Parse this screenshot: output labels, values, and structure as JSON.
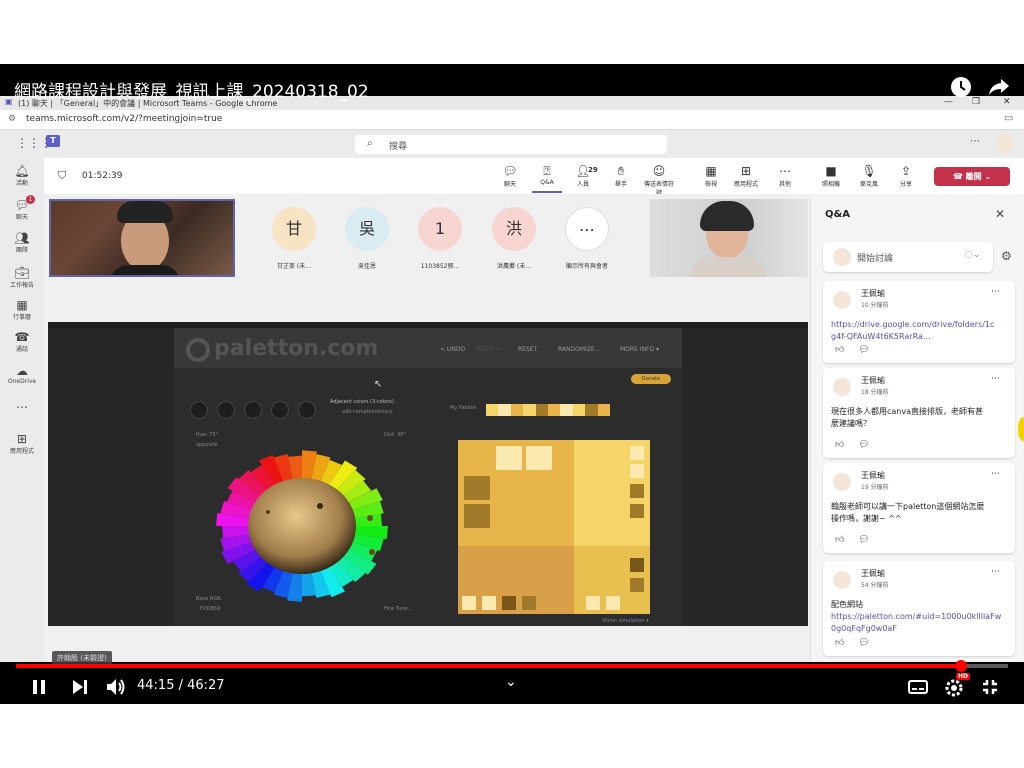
{
  "youtube": {
    "title": "網路課程設計與發展_視訊上課_20240318_02",
    "time_display": "44:15 / 46:27",
    "progress": 0.953,
    "caption_label": "許翰殷 (未驗證)",
    "hd_badge": "HD"
  },
  "chrome": {
    "window_title": "(1) 聊天 | 「General」中的會議 | Microsoft Teams - Google Chrome",
    "url": "teams.microsoft.com/v2/?meetingjoin=true"
  },
  "teams": {
    "search_placeholder": "搜尋",
    "rail": [
      {
        "label": "活動",
        "icon": "bell-icon"
      },
      {
        "label": "聊天",
        "icon": "chat-icon",
        "badge": "1"
      },
      {
        "label": "團隊",
        "icon": "teams-icon"
      },
      {
        "label": "工作報告",
        "icon": "briefcase-icon"
      },
      {
        "label": "行事曆",
        "icon": "calendar-icon"
      },
      {
        "label": "通話",
        "icon": "phone-icon"
      },
      {
        "label": "OneDrive",
        "icon": "cloud-icon"
      },
      {
        "label": "",
        "icon": "more-icon"
      },
      {
        "label": "應用程式",
        "icon": "add-apps-icon"
      }
    ],
    "meeting": {
      "timer": "01:52:39",
      "buttons": [
        {
          "label": "聊天",
          "icon": "chat-icon"
        },
        {
          "label": "Q&A",
          "icon": "qa-icon"
        },
        {
          "label": "人員",
          "icon": "people-icon",
          "count": "29"
        },
        {
          "label": "舉手",
          "icon": "hand-icon"
        },
        {
          "label": "傳送表情符號",
          "icon": "emoji-icon"
        },
        {
          "label": "檢視",
          "icon": "view-icon"
        },
        {
          "label": "應用程式",
          "icon": "apps-icon"
        },
        {
          "label": "其他",
          "icon": "more-icon"
        },
        {
          "label": "照相機",
          "icon": "camera-icon"
        },
        {
          "label": "麥克風",
          "icon": "mic-icon"
        },
        {
          "label": "分享",
          "icon": "share-icon"
        }
      ],
      "leave_label": "離開"
    },
    "participants": [
      {
        "initial": "甘",
        "name": "甘芷寧 (未...",
        "color": "#f7e4c4"
      },
      {
        "initial": "吳",
        "name": "吳佳恩",
        "color": "#d8ecf2"
      },
      {
        "initial": "1",
        "name": "1103852郭...",
        "color": "#f7d6d2"
      },
      {
        "initial": "洪",
        "name": "洪農蓁 (未...",
        "color": "#f7d6d2"
      },
      {
        "initial": "⋯",
        "name": "顯示所有與會者",
        "color": "#ffffff"
      }
    ]
  },
  "shared_screen": {
    "logo": "paletton.com",
    "menu": [
      "< UNDO",
      "REDO >",
      "RESET",
      "RANDOMIZE...",
      "MORE INFO ▾"
    ],
    "donate": "Donate",
    "scheme_title": "Adjacent colors (3-colors)",
    "scheme_sub": "add complementary",
    "hue_label": "Hue: 75°",
    "hue_sub": "opposite",
    "dist_label": "Dist: 30°",
    "base_rgb_label": "Base RGB:",
    "base_rgb_value": "FDD869",
    "fine_tune": "Fine Tune...",
    "my_palette": "My Palette",
    "vision": "Vision simulation ▾",
    "swatch_colors": {
      "main": "#e8b54a",
      "light": "#f5d46a",
      "dark": "#a07a28",
      "pale": "#fbe9b0",
      "deep": "#7a5518"
    }
  },
  "qa": {
    "title": "Q&A",
    "start_placeholder": "開始討論",
    "cards": [
      {
        "author": "王佩瑜",
        "time": "10 分鐘前",
        "lines": [
          "https://drive.google.com/drive/folders/1c",
          "g4f-QFAuW4t6K5RarRa..."
        ],
        "is_link": true
      },
      {
        "author": "王佩瑜",
        "time": "18 分鐘前",
        "lines": [
          "現在很多人都用canva直接排版，老師有甚",
          "麼建議嗎？"
        ],
        "is_link": false
      },
      {
        "author": "王佩瑜",
        "time": "19 分鐘前",
        "lines": [
          "翰殷老師可以講一下paletton這個網站怎麼",
          "操作嗎，謝謝~ ^^"
        ],
        "is_link": false
      },
      {
        "author": "王佩瑜",
        "time": "54 分鐘前",
        "lines": [
          "配色網站"
        ],
        "link_lines": [
          "https://paletton.com/#uid=1000u0kllllaFw",
          "0g0qFqFg0w0aF"
        ],
        "is_link": false
      }
    ]
  }
}
